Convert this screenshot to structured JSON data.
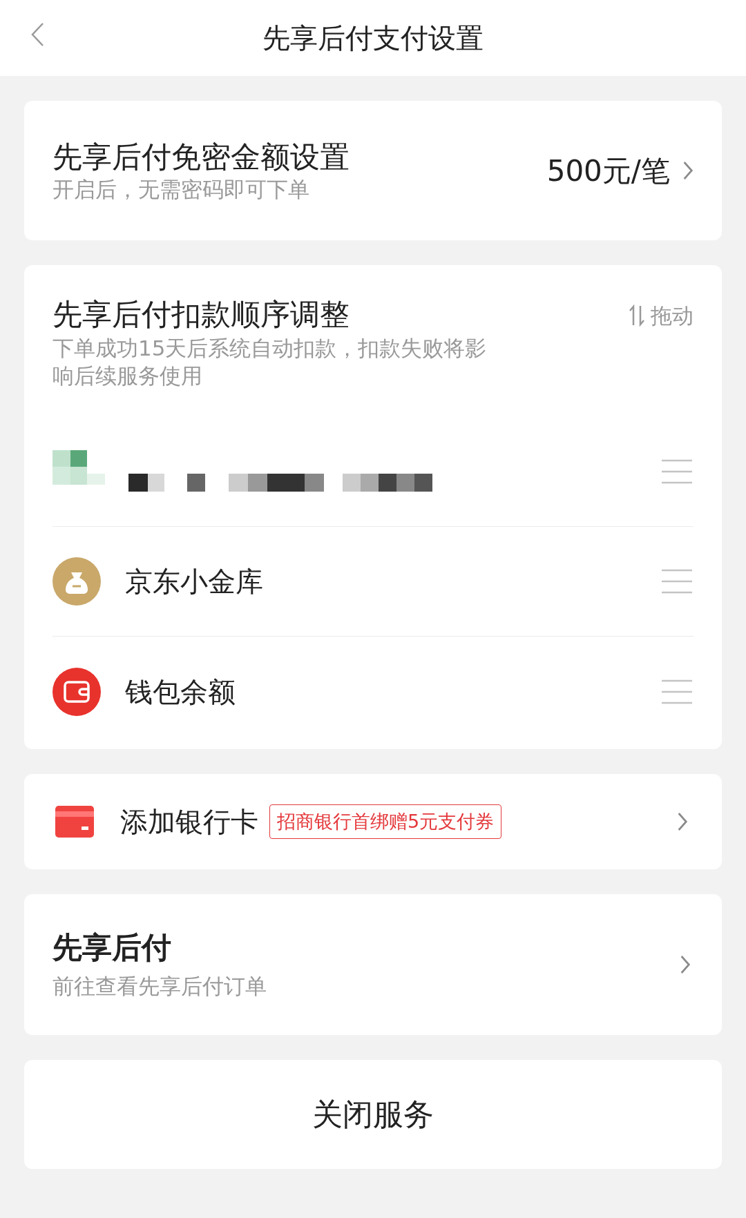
{
  "header": {
    "title": "先享后付支付设置"
  },
  "limit": {
    "title": "先享后付免密金额设置",
    "subtitle": "开启后，无需密码即可下单",
    "value": "500元/笔"
  },
  "order": {
    "title": "先享后付扣款顺序调整",
    "drag_label": "拖动",
    "description": "下单成功15天后系统自动扣款，扣款失败将影响后续服务使用",
    "methods": [
      {
        "kind": "redacted"
      },
      {
        "kind": "vault",
        "name": "京东小金库"
      },
      {
        "kind": "wallet",
        "name": "钱包余额"
      }
    ]
  },
  "bank": {
    "label": "添加银行卡",
    "promo": "招商银行首绑赠5元支付券"
  },
  "orders_link": {
    "title": "先享后付",
    "subtitle": "前往查看先享后付订单"
  },
  "close_button": "关闭服务"
}
